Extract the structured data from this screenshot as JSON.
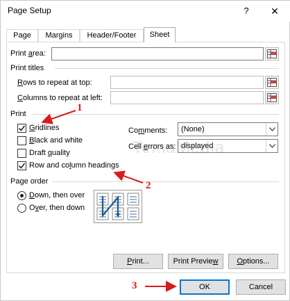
{
  "window": {
    "title": "Page Setup",
    "help_glyph": "?",
    "close_glyph": "✕"
  },
  "tabs": [
    {
      "label": "Page",
      "active": false
    },
    {
      "label": "Margins",
      "active": false
    },
    {
      "label": "Header/Footer",
      "active": false
    },
    {
      "label": "Sheet",
      "active": true
    }
  ],
  "print_area": {
    "label_pre": "Print ",
    "label_u": "a",
    "label_post": "rea:",
    "value": ""
  },
  "print_titles": {
    "heading": "Print titles",
    "rows_label_u": "R",
    "rows_label_post": "ows to repeat at top:",
    "rows_value": "",
    "cols_label_u": "C",
    "cols_label_post": "olumns to repeat at left:",
    "cols_value": ""
  },
  "print": {
    "heading": "Print",
    "gridlines": {
      "label_u": "G",
      "label_post": "ridlines",
      "checked": true
    },
    "black_white": {
      "label_u": "B",
      "label_post": "lack and white",
      "checked": false
    },
    "draft": {
      "label_pre": "Draft ",
      "label_u": "q",
      "label_post": "uality",
      "checked": false
    },
    "headings": {
      "label_pre": "Row and co",
      "label_u": "l",
      "label_post": "umn headings",
      "checked": true
    },
    "comments_label_pre": "Co",
    "comments_label_u": "m",
    "comments_label_post": "ments:",
    "comments_value": "(None)",
    "errors_label_pre": "Cell ",
    "errors_label_u": "e",
    "errors_label_post": "rrors as:",
    "errors_value": "displayed"
  },
  "page_order": {
    "heading": "Page order",
    "down_over": {
      "label_u": "D",
      "label_post": "own, then over",
      "selected": true
    },
    "over_down": {
      "label_pre": "O",
      "label_u": "v",
      "label_post": "er, then down",
      "selected": false
    }
  },
  "buttons": {
    "print_u": "P",
    "print_post": "rint...",
    "preview_pre": "Print Previe",
    "preview_u": "w",
    "preview_post": "",
    "options_u": "O",
    "options_post": "ptions...",
    "ok": "OK",
    "cancel": "Cancel"
  },
  "annotations": [
    "1",
    "2",
    "3"
  ],
  "watermark": "TemaMedia",
  "colors": {
    "annotation_red": "#d81b1b",
    "default_button_border": "#0078d7"
  }
}
